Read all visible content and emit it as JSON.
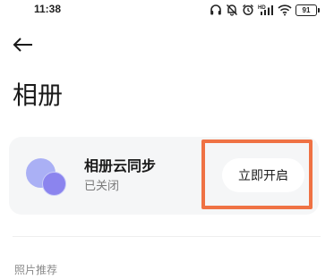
{
  "status_bar": {
    "time": "11:38",
    "battery": "91",
    "icons": [
      "headphones-icon",
      "mute-icon",
      "alarm-icon",
      "signal-hd-icon",
      "wifi-icon",
      "battery-icon"
    ]
  },
  "header": {
    "back_icon": "back-arrow-icon",
    "title": "相册"
  },
  "cloud_sync": {
    "icon": "cloud-sync-icon",
    "title": "相册云同步",
    "status": "已关闭",
    "enable_label": "立即开启",
    "highlight_color": "#ef7244"
  },
  "sections": {
    "photo_recommendations": "照片推荐"
  }
}
